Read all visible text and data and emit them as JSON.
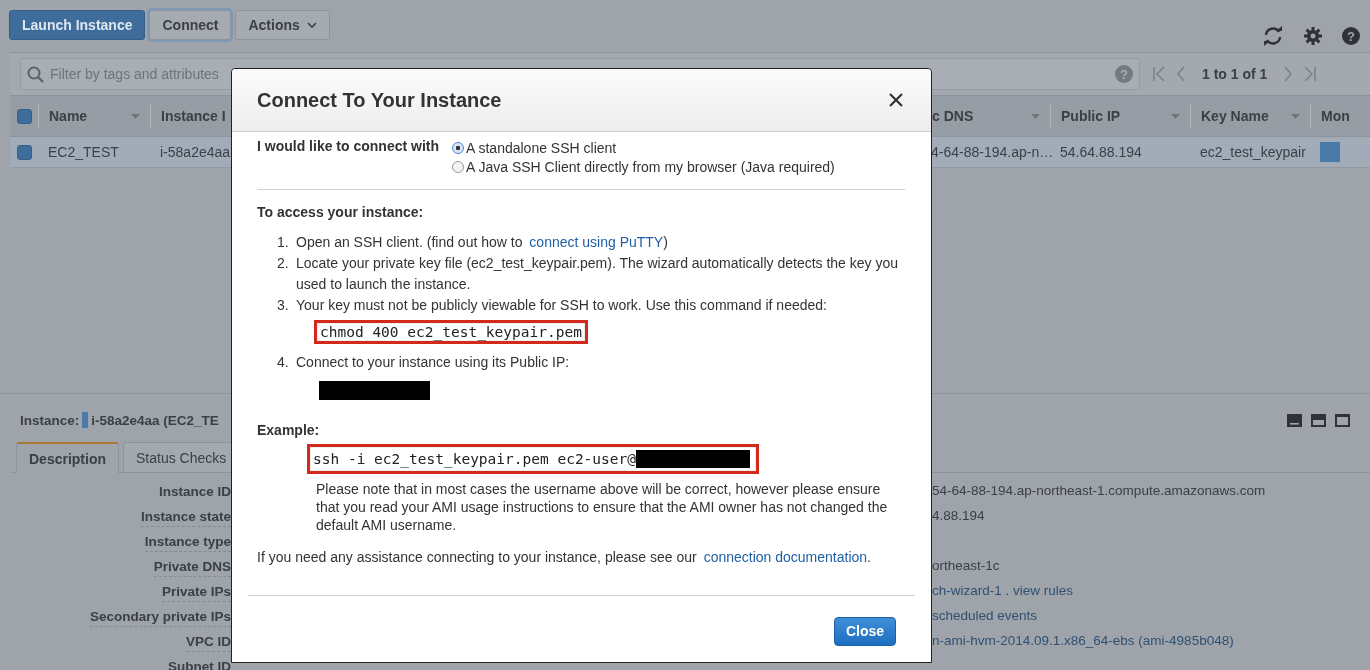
{
  "toolbar": {
    "help_glyph": "?",
    "buttons": [
      {
        "label": "Launch Instance",
        "kind": "primary"
      },
      {
        "label": "Connect",
        "kind": "focused"
      },
      {
        "label": "Actions",
        "kind": "dropdown"
      }
    ]
  },
  "filter": {
    "help_glyph": "?",
    "placeholder": "Filter by tags and attributes"
  },
  "pagination": {
    "text": "1 to 1 of 1"
  },
  "table": {
    "all_checked": true,
    "columns": [
      {
        "label": "Name",
        "sortable": true
      },
      {
        "label": "Instance I"
      },
      {
        "label": "c DNS",
        "sortable": true
      },
      {
        "label": "Public IP",
        "sortable": true
      },
      {
        "label": "Key Name",
        "sortable": true
      },
      {
        "label": "Mon",
        "sortable": false
      }
    ],
    "rows": [
      {
        "selected": true,
        "cells": [
          "EC2_TEST",
          "i-58a2e4aa",
          "4-64-88-194.ap-n…",
          "54.64.88.194",
          "ec2_test_keypair"
        ],
        "monitoring": true
      }
    ]
  },
  "details": {
    "instance_label": "Instance:",
    "instance_value": "i-58a2e4aa (EC2_TE",
    "tabs": [
      {
        "label": "Description",
        "selected": true
      },
      {
        "label": "Status Checks",
        "selected": false
      }
    ],
    "rows": [
      {
        "label": "Instance ID",
        "underlined": false,
        "value": [
          {
            "kind": "text",
            "text": "54-64-88-194.ap-northeast-1.compute.amazonaws.com"
          }
        ]
      },
      {
        "label": "Instance state",
        "underlined": true,
        "value": [
          {
            "kind": "text",
            "text": "4.88.194"
          }
        ]
      },
      {
        "label": "Instance type",
        "underlined": true,
        "value": []
      },
      {
        "label": "Private DNS",
        "underlined": true,
        "value": [
          {
            "kind": "text",
            "text": "ortheast-1c"
          }
        ]
      },
      {
        "label": "Private IPs",
        "underlined": true,
        "value": [
          {
            "kind": "link",
            "text": "ch-wizard-1"
          },
          {
            "kind": "text",
            "text": " . "
          },
          {
            "kind": "link",
            "text": "view rules"
          }
        ]
      },
      {
        "label": "Secondary private IPs",
        "underlined": true,
        "value": [
          {
            "kind": "link",
            "text": "scheduled events"
          }
        ]
      },
      {
        "label": "VPC ID",
        "underlined": true,
        "value": [
          {
            "kind": "link",
            "text": "n-ami-hvm-2014.09.1.x86_64-ebs (ami-4985b048)"
          }
        ]
      },
      {
        "label": "Subnet ID",
        "underlined": false,
        "value": []
      }
    ]
  },
  "dialog": {
    "title": "Connect To Your Instance",
    "connect_label": "I would like to connect with",
    "options": [
      {
        "label": "A standalone SSH client",
        "selected": true
      },
      {
        "label": "A Java SSH Client directly from my browser (Java required)",
        "selected": false
      }
    ],
    "access_heading": "To access your instance:",
    "steps": [
      {
        "number": "1.",
        "parts": [
          {
            "kind": "text",
            "text": "Open an SSH client. (find out how to "
          },
          {
            "kind": "link",
            "text": "connect using PuTTY"
          },
          {
            "kind": "text",
            "text": ")"
          }
        ],
        "redacted": false
      },
      {
        "number": "2.",
        "parts": [
          {
            "kind": "text",
            "text": "Locate your private key file (ec2_test_keypair.pem). The wizard automatically detects the key you used to launch the instance."
          }
        ],
        "redacted": false
      },
      {
        "number": "3.",
        "parts": [
          {
            "kind": "text",
            "text": "Your key must not be publicly viewable for SSH to work. Use this command if needed:"
          }
        ],
        "command": "chmod 400 ec2_test_keypair.pem",
        "redacted": false
      },
      {
        "number": "4.",
        "parts": [
          {
            "kind": "text",
            "text": "Connect to your instance using its Public IP:"
          }
        ],
        "redacted": true
      }
    ],
    "example_heading": "Example:",
    "example_command": "ssh -i ec2_test_keypair.pem ec2-user@",
    "example_redacted": true,
    "note": "Please note that in most cases the username above will be correct, however please ensure that you read your AMI usage instructions to ensure that the AMI owner has not changed the default AMI username.",
    "assistance": [
      {
        "kind": "text",
        "text": "If you need any assistance connecting to your instance, please see our "
      },
      {
        "kind": "link",
        "text": "connection documentation"
      },
      {
        "kind": "text",
        "text": "."
      }
    ],
    "close_button": "Close"
  }
}
